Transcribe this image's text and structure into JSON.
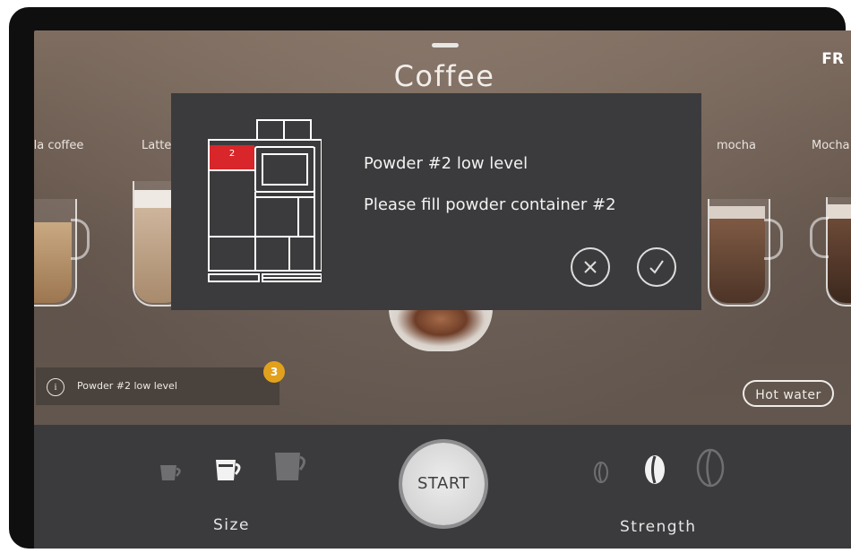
{
  "header": {
    "title": "Coffee",
    "language": "FR"
  },
  "drinks": {
    "left_partial": "lla coffee",
    "left": "Latte",
    "right": "mocha",
    "right_partial": "Mocha"
  },
  "notification": {
    "text": "Powder #2 low level",
    "badge_count": "3"
  },
  "hot_water_label": "Hot water",
  "bottom": {
    "size_label": "Size",
    "start_label": "START",
    "strength_label": "Strength"
  },
  "dialog": {
    "container_number": "2",
    "title": "Powder #2 low level",
    "message": "Please fill powder container #2"
  },
  "colors": {
    "accent_red": "#d8262a",
    "badge": "#e2a11c",
    "panel": "#3b3b3d"
  },
  "icons": [
    "info-icon",
    "cancel-x-icon",
    "confirm-check-icon",
    "coffee-machine-icon",
    "cup-icon",
    "coffee-bean-icon"
  ]
}
